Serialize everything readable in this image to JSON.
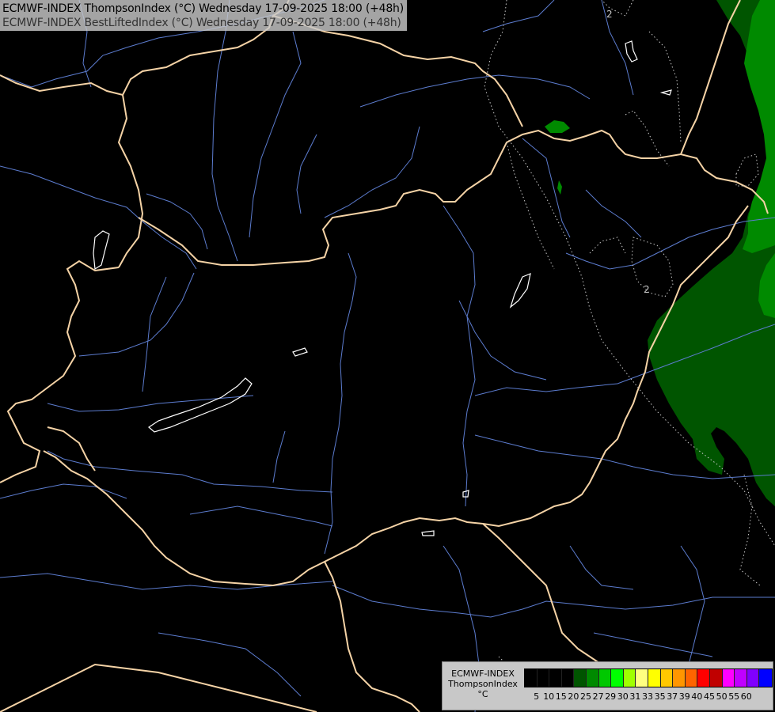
{
  "title": {
    "line1": "ECMWF-INDEX ThompsonIndex (°C) Wednesday 17-09-2025 18:00 (+48h)",
    "line2": "ECMWF-INDEX BestLiftedIndex (°C) Wednesday 17-09-2025 18:00 (+48h)"
  },
  "map": {
    "contour_labels": [
      "2",
      "2"
    ],
    "colors": {
      "background": "#000000",
      "borders": "#f5d3a6",
      "rivers": "#5c7ccf",
      "lakes": "#ffffff",
      "contours": "#c8c8c8",
      "field_dark": "#005500",
      "field_mid": "#008a00"
    }
  },
  "legend": {
    "label_lines": [
      "ECMWF-INDEX",
      "ThompsonIndex",
      "°C"
    ],
    "ticks": [
      "5",
      "10",
      "15",
      "20",
      "25",
      "27",
      "29",
      "30",
      "31",
      "33",
      "35",
      "37",
      "39",
      "40",
      "45",
      "50",
      "55",
      "60"
    ],
    "colors": [
      "#000000",
      "#000000",
      "#000000",
      "#000000",
      "#005500",
      "#008a00",
      "#00c800",
      "#00ff00",
      "#a0ff00",
      "#ffff80",
      "#ffff00",
      "#ffc800",
      "#ff9600",
      "#ff6400",
      "#ff0000",
      "#c00000",
      "#ff00ff",
      "#c000ff",
      "#8000ff",
      "#0000ff"
    ]
  }
}
